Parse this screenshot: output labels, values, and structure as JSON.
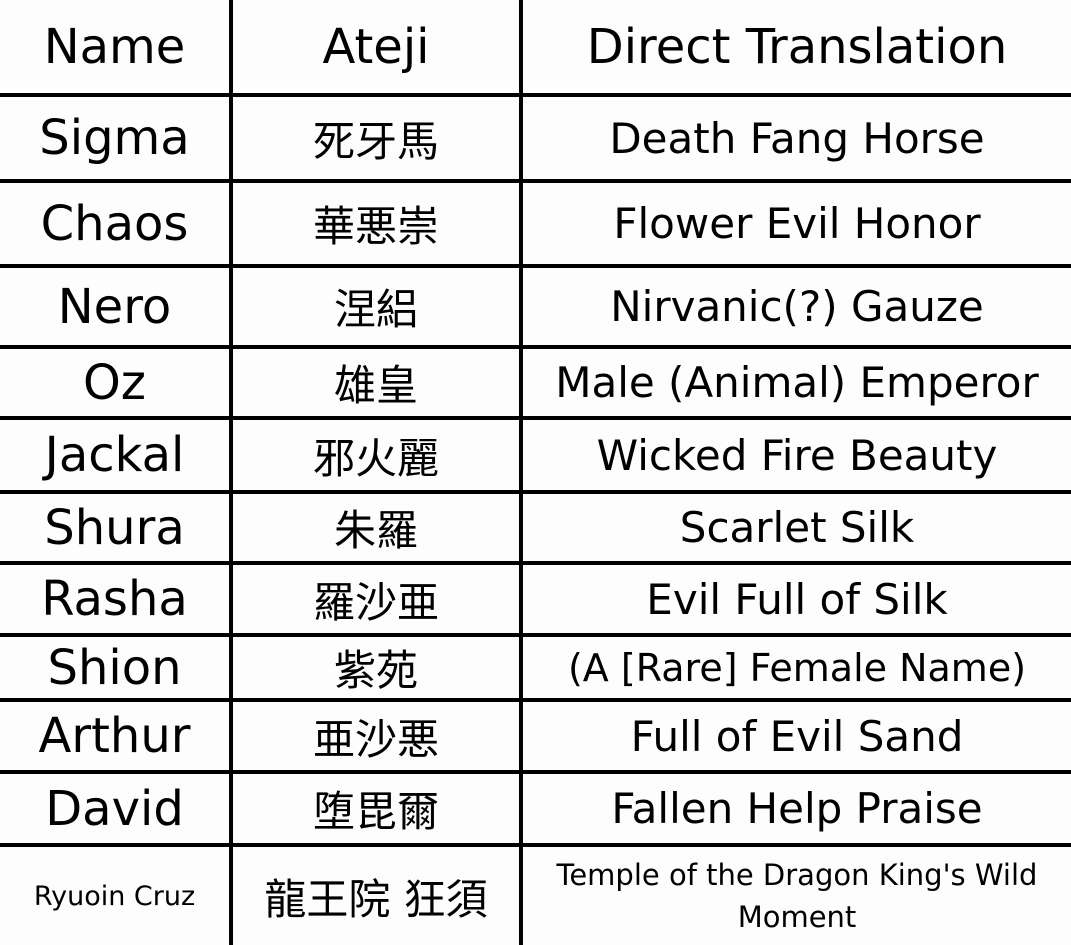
{
  "headers": [
    "Name",
    "Ateji",
    "Direct Translation"
  ],
  "rows": [
    {
      "name": "Sigma",
      "ateji": "死牙馬",
      "translation": "Death Fang Horse"
    },
    {
      "name": "Chaos",
      "ateji": "華悪崇",
      "translation": "Flower Evil Honor"
    },
    {
      "name": "Nero",
      "ateji": "涅絽",
      "translation": "Nirvanic(?) Gauze"
    },
    {
      "name": "Oz",
      "ateji": "雄皇",
      "translation": "Male (Animal) Emperor"
    },
    {
      "name": "Jackal",
      "ateji": "邪火麗",
      "translation": "Wicked Fire Beauty"
    },
    {
      "name": "Shura",
      "ateji": "朱羅",
      "translation": "Scarlet Silk"
    },
    {
      "name": "Rasha",
      "ateji": "羅沙亜",
      "translation": "Evil Full of Silk"
    },
    {
      "name": "Shion",
      "ateji": "紫苑",
      "translation": "(A [Rare] Female Name)"
    },
    {
      "name": "Arthur",
      "ateji": "亜沙悪",
      "translation": "Full of Evil Sand"
    },
    {
      "name": "David",
      "ateji": "堕毘爾",
      "translation": "Fallen Help Praise"
    },
    {
      "name": "Ryuoin Cruz",
      "ateji": "龍王院 狂須",
      "translation": "Temple of the Dragon King's Wild Moment"
    }
  ]
}
